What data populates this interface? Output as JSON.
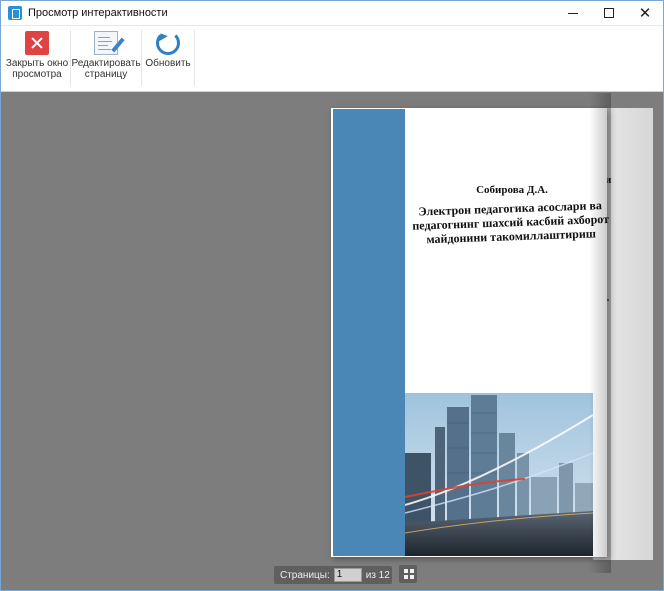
{
  "window": {
    "title": "Просмотр интерактивности",
    "controls": {
      "minimize": "minimize-icon",
      "maximize": "maximize-icon",
      "close": "✕"
    }
  },
  "toolbar": {
    "close_preview": {
      "label_line1": "Закрыть окно",
      "label_line2": "просмотра",
      "icon": "close-x-icon"
    },
    "edit_page": {
      "label_line1": "Редактировать",
      "label_line2": "страницу",
      "icon": "edit-page-icon"
    },
    "refresh": {
      "label": "Обновить",
      "icon": "refresh-icon"
    }
  },
  "book": {
    "author": "Собирова Д.А.",
    "title_lines": [
      "Электрон педагогика асослари ва",
      "педагогнинг шахсий касбий ахборот",
      "майдонини такомиллаштириш"
    ],
    "back_page_fragments": [
      "и",
      ",",
      ",",
      "Д.",
      "о,"
    ],
    "spine_color": "#4a86b6"
  },
  "pager": {
    "label": "Страницы:",
    "current": "1",
    "of_label": "из 12"
  },
  "colors": {
    "workspace": "#7d7d7d",
    "accent": "#2f7fc4",
    "close_red": "#e04343"
  }
}
